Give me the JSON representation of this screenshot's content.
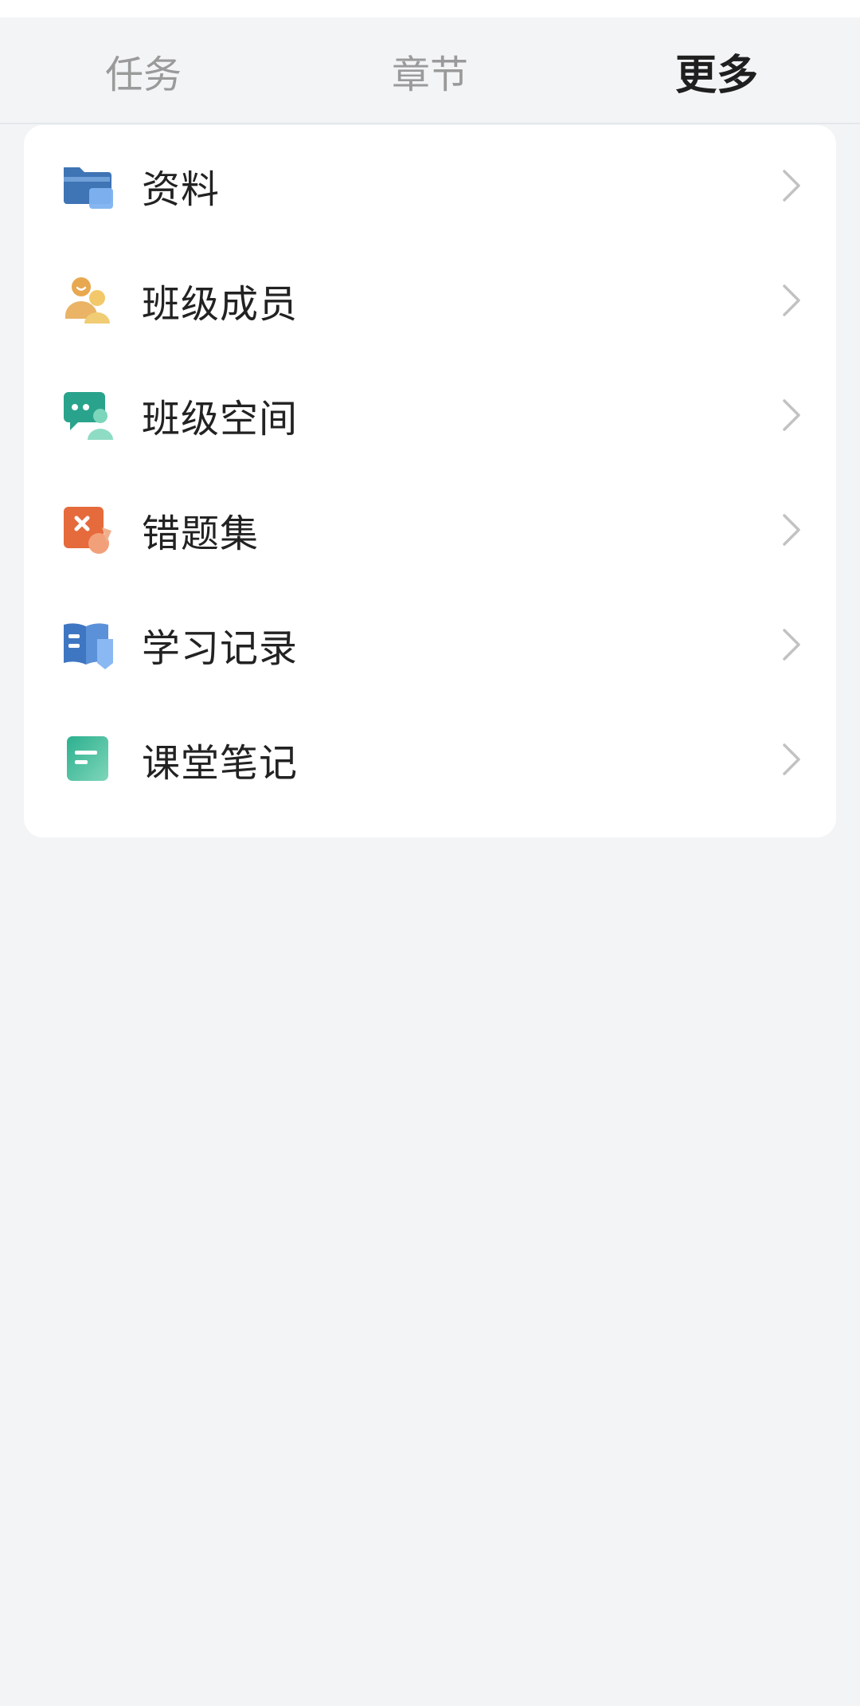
{
  "tabs": [
    {
      "label": "任务",
      "active": false
    },
    {
      "label": "章节",
      "active": false
    },
    {
      "label": "更多",
      "active": true
    }
  ],
  "accent_color": "#1493f0",
  "menu": {
    "items": [
      {
        "label": "资料",
        "icon": "folder-icon"
      },
      {
        "label": "班级成员",
        "icon": "members-icon"
      },
      {
        "label": "班级空间",
        "icon": "chat-space-icon"
      },
      {
        "label": "错题集",
        "icon": "wrong-answers-icon"
      },
      {
        "label": "学习记录",
        "icon": "study-record-icon"
      },
      {
        "label": "课堂笔记",
        "icon": "notes-icon"
      }
    ]
  }
}
